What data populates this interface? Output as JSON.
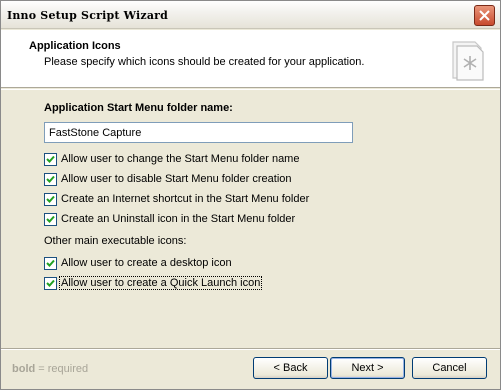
{
  "window": {
    "title": "Inno Setup Script Wizard"
  },
  "header": {
    "title": "Application Icons",
    "subtitle": "Please specify which icons should be created for your application."
  },
  "form": {
    "folder_label": "Application Start Menu folder name:",
    "folder_value": "FastStone Capture",
    "options": [
      {
        "label": "Allow user to change the Start Menu folder name",
        "checked": true
      },
      {
        "label": "Allow user to disable Start Menu folder creation",
        "checked": true
      },
      {
        "label": "Create an Internet shortcut in the Start Menu folder",
        "checked": true
      },
      {
        "label": "Create an Uninstall icon in the Start Menu folder",
        "checked": true
      }
    ],
    "other_label": "Other main executable icons:",
    "other_options": [
      {
        "label": "Allow user to create a desktop icon",
        "checked": true
      },
      {
        "label": "Allow user to create a Quick Launch icon",
        "checked": true
      }
    ]
  },
  "footer": {
    "note_bold": "bold",
    "note_rest": " = required",
    "back_label": "< Back",
    "next_label": "Next >",
    "cancel_label": "Cancel"
  },
  "colors": {
    "check_mark": "#21a121",
    "input_border": "#7f9db9",
    "button_border": "#003c74"
  },
  "icons": {
    "close": "close-icon",
    "header": "wizard-page-icon",
    "check": "checkmark-icon"
  }
}
